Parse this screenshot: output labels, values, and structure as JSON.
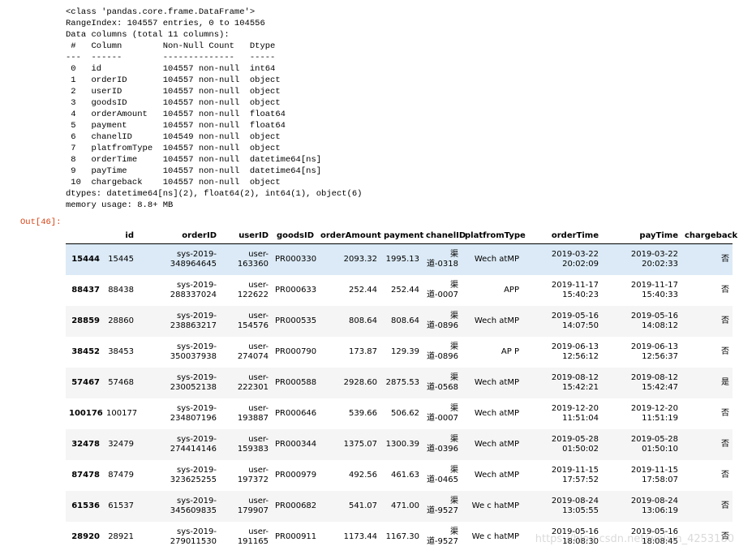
{
  "info_lines": [
    "<class 'pandas.core.frame.DataFrame'>",
    "RangeIndex: 104557 entries, 0 to 104556",
    "Data columns (total 11 columns):",
    " #   Column        Non-Null Count   Dtype",
    "---  ------        --------------   -----",
    " 0   id            104557 non-null  int64",
    " 1   orderID       104557 non-null  object",
    " 2   userID        104557 non-null  object",
    " 3   goodsID       104557 non-null  object",
    " 4   orderAmount   104557 non-null  float64",
    " 5   payment       104557 non-null  float64",
    " 6   chanelID      104549 non-null  object",
    " 7   platfromType  104557 non-null  object",
    " 8   orderTime     104557 non-null  datetime64[ns]",
    " 9   payTime       104557 non-null  datetime64[ns]",
    " 10  chargeback    104557 non-null  object",
    "dtypes: datetime64[ns](2), float64(2), int64(1), object(6)",
    "memory usage: 8.8+ MB"
  ],
  "out_label": "Out[46]:",
  "columns": [
    "",
    "id",
    "orderID",
    "userID",
    "goodsID",
    "orderAmount",
    "payment",
    "chanelID",
    "platfromType",
    "orderTime",
    "payTime",
    "chargeback"
  ],
  "rows": [
    {
      "idx": "15444",
      "id": "15445",
      "orderID": "sys-2019-348964645",
      "userID": "user-163360",
      "goodsID": "PR000330",
      "orderAmount": "2093.32",
      "payment": "1995.13",
      "chanelID": "渠道-0318",
      "platfromType": "Wech atMP",
      "orderTime": "2019-03-22 20:02:09",
      "payTime": "2019-03-22 20:02:33",
      "chargeback": "否"
    },
    {
      "idx": "88437",
      "id": "88438",
      "orderID": "sys-2019-288337024",
      "userID": "user-122622",
      "goodsID": "PR000633",
      "orderAmount": "252.44",
      "payment": "252.44",
      "chanelID": "渠道-0007",
      "platfromType": "APP",
      "orderTime": "2019-11-17 15:40:23",
      "payTime": "2019-11-17 15:40:33",
      "chargeback": "否"
    },
    {
      "idx": "28859",
      "id": "28860",
      "orderID": "sys-2019-238863217",
      "userID": "user-154576",
      "goodsID": "PR000535",
      "orderAmount": "808.64",
      "payment": "808.64",
      "chanelID": "渠道-0896",
      "platfromType": "Wech atMP",
      "orderTime": "2019-05-16 14:07:50",
      "payTime": "2019-05-16 14:08:12",
      "chargeback": "否"
    },
    {
      "idx": "38452",
      "id": "38453",
      "orderID": "sys-2019-350037938",
      "userID": "user-274074",
      "goodsID": "PR000790",
      "orderAmount": "173.87",
      "payment": "129.39",
      "chanelID": "渠道-0896",
      "platfromType": "AP P",
      "orderTime": "2019-06-13 12:56:12",
      "payTime": "2019-06-13 12:56:37",
      "chargeback": "否"
    },
    {
      "idx": "57467",
      "id": "57468",
      "orderID": "sys-2019-230052138",
      "userID": "user-222301",
      "goodsID": "PR000588",
      "orderAmount": "2928.60",
      "payment": "2875.53",
      "chanelID": "渠道-0568",
      "platfromType": "Wech atMP",
      "orderTime": "2019-08-12 15:42:21",
      "payTime": "2019-08-12 15:42:47",
      "chargeback": "是"
    },
    {
      "idx": "100176",
      "id": "100177",
      "orderID": "sys-2019-234807196",
      "userID": "user-193887",
      "goodsID": "PR000646",
      "orderAmount": "539.66",
      "payment": "506.62",
      "chanelID": "渠道-0007",
      "platfromType": "Wech atMP",
      "orderTime": "2019-12-20 11:51:04",
      "payTime": "2019-12-20 11:51:19",
      "chargeback": "否"
    },
    {
      "idx": "32478",
      "id": "32479",
      "orderID": "sys-2019-274414146",
      "userID": "user-159383",
      "goodsID": "PR000344",
      "orderAmount": "1375.07",
      "payment": "1300.39",
      "chanelID": "渠道-0396",
      "platfromType": "Wech atMP",
      "orderTime": "2019-05-28 01:50:02",
      "payTime": "2019-05-28 01:50:10",
      "chargeback": "否"
    },
    {
      "idx": "87478",
      "id": "87479",
      "orderID": "sys-2019-323625255",
      "userID": "user-197372",
      "goodsID": "PR000979",
      "orderAmount": "492.56",
      "payment": "461.63",
      "chanelID": "渠道-0465",
      "platfromType": "Wech atMP",
      "orderTime": "2019-11-15 17:57:52",
      "payTime": "2019-11-15 17:58:07",
      "chargeback": "否"
    },
    {
      "idx": "61536",
      "id": "61537",
      "orderID": "sys-2019-345609835",
      "userID": "user-179907",
      "goodsID": "PR000682",
      "orderAmount": "541.07",
      "payment": "471.00",
      "chanelID": "渠道-9527",
      "platfromType": "We c hatMP",
      "orderTime": "2019-08-24 13:05:55",
      "payTime": "2019-08-24 13:06:19",
      "chargeback": "否"
    },
    {
      "idx": "28920",
      "id": "28921",
      "orderID": "sys-2019-279011530",
      "userID": "user-191165",
      "goodsID": "PR000911",
      "orderAmount": "1173.44",
      "payment": "1167.30",
      "chanelID": "渠道-9527",
      "platfromType": "We c hatMP",
      "orderTime": "2019-05-16 18:08:30",
      "payTime": "2019-05-16 18:08:45",
      "chargeback": "否"
    }
  ],
  "watermark": "https://blog.csdn.net/weixin_4253180"
}
